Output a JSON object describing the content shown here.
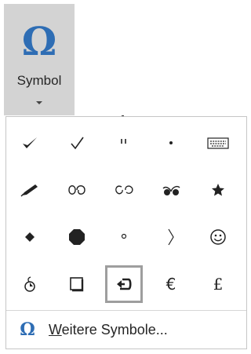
{
  "ribbon": {
    "omega_glyph": "Ω",
    "label": "Symbol",
    "accent_color": "#2e6db4"
  },
  "gallery": {
    "symbols": [
      [
        "✓ heavy",
        "✓",
        "\"",
        "·",
        "keyboard"
      ],
      [
        "pen",
        "ornament-1",
        "ornament-2",
        "ornament-3",
        "★"
      ],
      [
        "◆",
        "⬢",
        "°",
        "〉",
        "☺"
      ],
      [
        "bomb",
        "☐",
        "return-arrow",
        "€",
        "£"
      ]
    ],
    "selected": "return-arrow"
  },
  "more": {
    "omega_glyph": "Ω",
    "mnemonic": "W",
    "rest": "eitere Symbole..."
  }
}
